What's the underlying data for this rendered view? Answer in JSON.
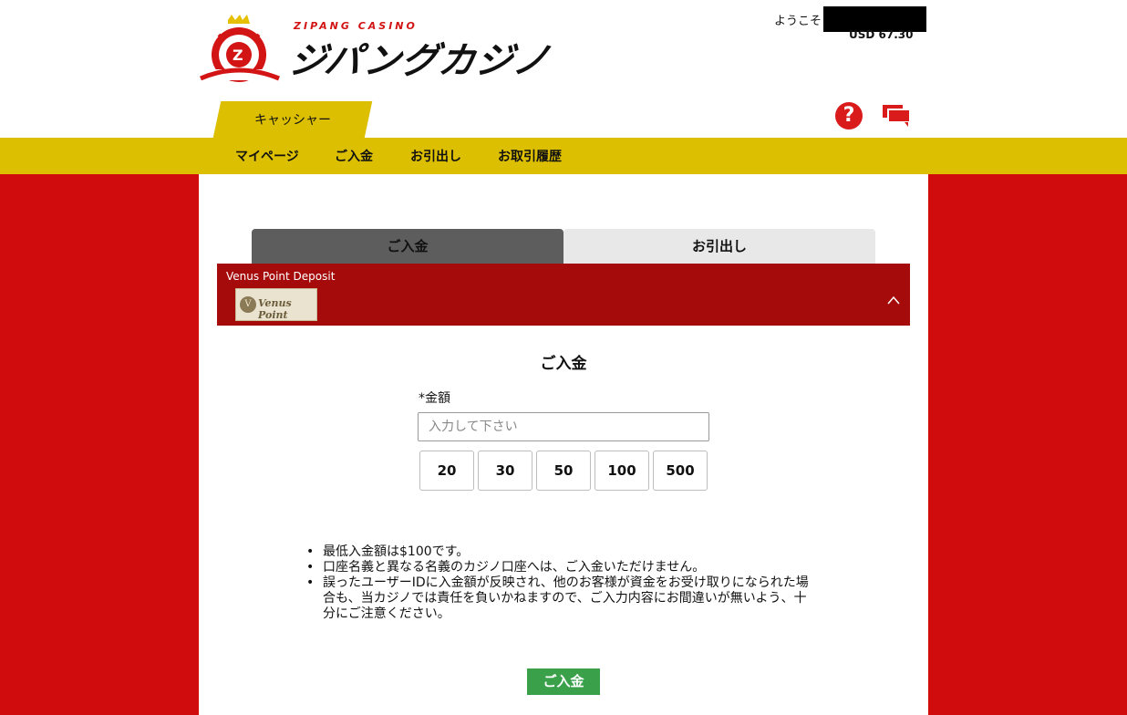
{
  "header": {
    "logo_small": "ZIPANG CASINO",
    "logo_main": "ジパングカジノ",
    "welcome": "ようこそ",
    "balance": "USD 67.30"
  },
  "cashier_tab": "キャッシャー",
  "nav": {
    "items": [
      "マイページ",
      "ご入金",
      "お引出し",
      "お取引履歴"
    ]
  },
  "tabs": {
    "deposit": "ご入金",
    "withdraw": "お引出し"
  },
  "method": {
    "title": "Venus Point Deposit",
    "logo_text": "Venus Point",
    "logo_emblem": "V"
  },
  "form": {
    "section_title": "ご入金",
    "amount_label": "*金額",
    "amount_placeholder": "入力して下さい",
    "presets": [
      "20",
      "30",
      "50",
      "100",
      "500"
    ]
  },
  "notes": [
    "最低入金額は$100です。",
    "口座名義と異なる名義のカジノ口座へは、ご入金いただけません。",
    "誤ったユーザーIDに入金額が反映され、他のお客様が資金をお受け取りになられた場合も、当カジノでは責任を負いかねますので、ご入力内容にお間違いが無いよう、十分にご注意ください。"
  ],
  "submit_label": "ご入金",
  "bullet": "•",
  "icons": {
    "help": "?",
    "chat": "chat-icon",
    "chevron": "chevron-up-icon"
  },
  "colors": {
    "brand_red": "#d00c0c",
    "nav_yellow": "#dcbf00",
    "method_bar": "#a50b0b",
    "submit_green": "#3aa14a",
    "active_tab": "#5d5d5d"
  }
}
